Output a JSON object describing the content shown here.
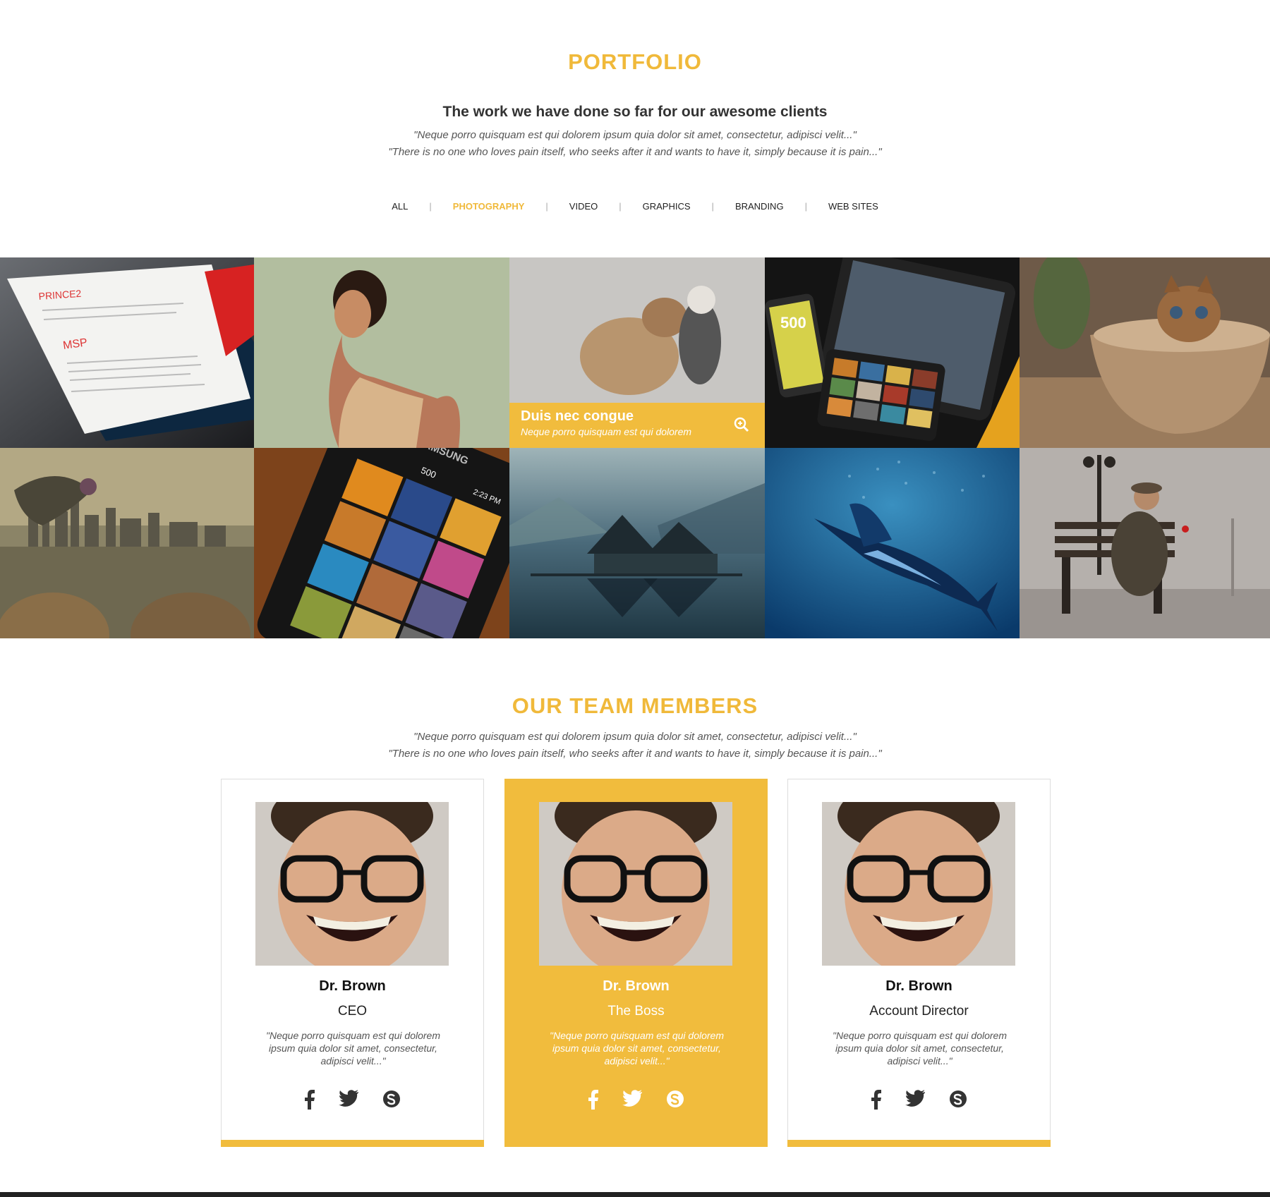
{
  "portfolio": {
    "title": "PORTFOLIO",
    "subtitle": "The work we have done so far for our awesome clients",
    "quote1": "\"Neque porro quisquam est qui dolorem ipsum quia dolor sit amet, consectetur, adipisci velit...\"",
    "quote2": "\"There is no one who loves pain itself, who seeks after it and wants to have it, simply because it is pain...\"",
    "filters": [
      "ALL",
      "PHOTOGRAPHY",
      "VIDEO",
      "GRAPHICS",
      "BRANDING",
      "WEB SITES"
    ],
    "active_filter": "PHOTOGRAPHY",
    "hover_item": {
      "title": "Duis nec congue",
      "caption": "Neque porro quisquam est qui dolorem"
    },
    "image_labels": {
      "doc_heading": "PRINCE2",
      "doc_sub": "MSP",
      "device_brand": "SAMSUNG",
      "app_name": "500",
      "clock": "2:23 PM"
    }
  },
  "team": {
    "title": "OUR TEAM MEMBERS",
    "quote1": "\"Neque porro quisquam est qui dolorem ipsum quia dolor sit amet, consectetur, adipisci velit...\"",
    "quote2": "\"There is no one who loves pain itself, who seeks after it and wants to have it, simply because it is pain...\"",
    "members": [
      {
        "name": "Dr. Brown",
        "role": "CEO",
        "bio": "\"Neque porro quisquam est qui dolorem ipsum quia dolor sit amet, consectetur, adipisci velit...\""
      },
      {
        "name": "Dr. Brown",
        "role": "The Boss",
        "bio": "\"Neque porro quisquam est qui dolorem ipsum quia dolor sit amet, consectetur, adipisci velit...\""
      },
      {
        "name": "Dr. Brown",
        "role": "Account Director",
        "bio": "\"Neque porro quisquam est qui dolorem ipsum quia dolor sit amet, consectetur, adipisci velit...\""
      }
    ]
  },
  "colors": {
    "accent": "#f1bc3d",
    "text": "#333333",
    "muted": "#555555"
  },
  "icons": [
    "zoom-icon",
    "facebook-icon",
    "twitter-icon",
    "skype-icon"
  ]
}
